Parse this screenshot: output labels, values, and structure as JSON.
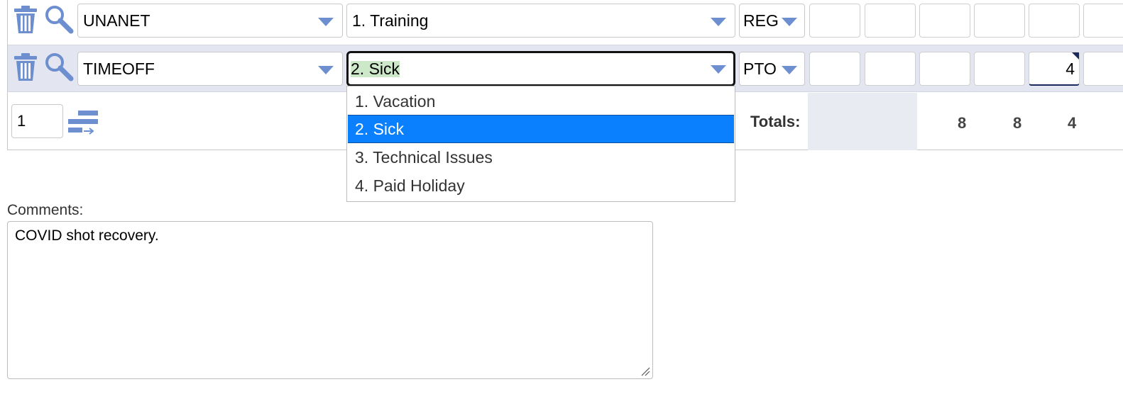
{
  "rows": [
    {
      "project": "UNANET",
      "task": "1. Training",
      "type": "REG"
    },
    {
      "project": "TIMEOFF",
      "task": "2. Sick",
      "type": "PTO",
      "hour_value": "4"
    }
  ],
  "task_dropdown": {
    "options": [
      "1. Vacation",
      "2. Sick",
      "3. Technical Issues",
      "4. Paid Holiday"
    ],
    "selected": "2. Sick"
  },
  "footer": {
    "add_rows_count": "1",
    "totals_label": "Totals:",
    "totals": [
      "8",
      "8",
      "4"
    ]
  },
  "comments": {
    "label": "Comments:",
    "value": "COVID shot recovery."
  },
  "colors": {
    "accent": "#6d8fd0",
    "selected_option": "#0a80ff",
    "active_row": "#e3e6f0",
    "highlight": "#cde8c8"
  }
}
